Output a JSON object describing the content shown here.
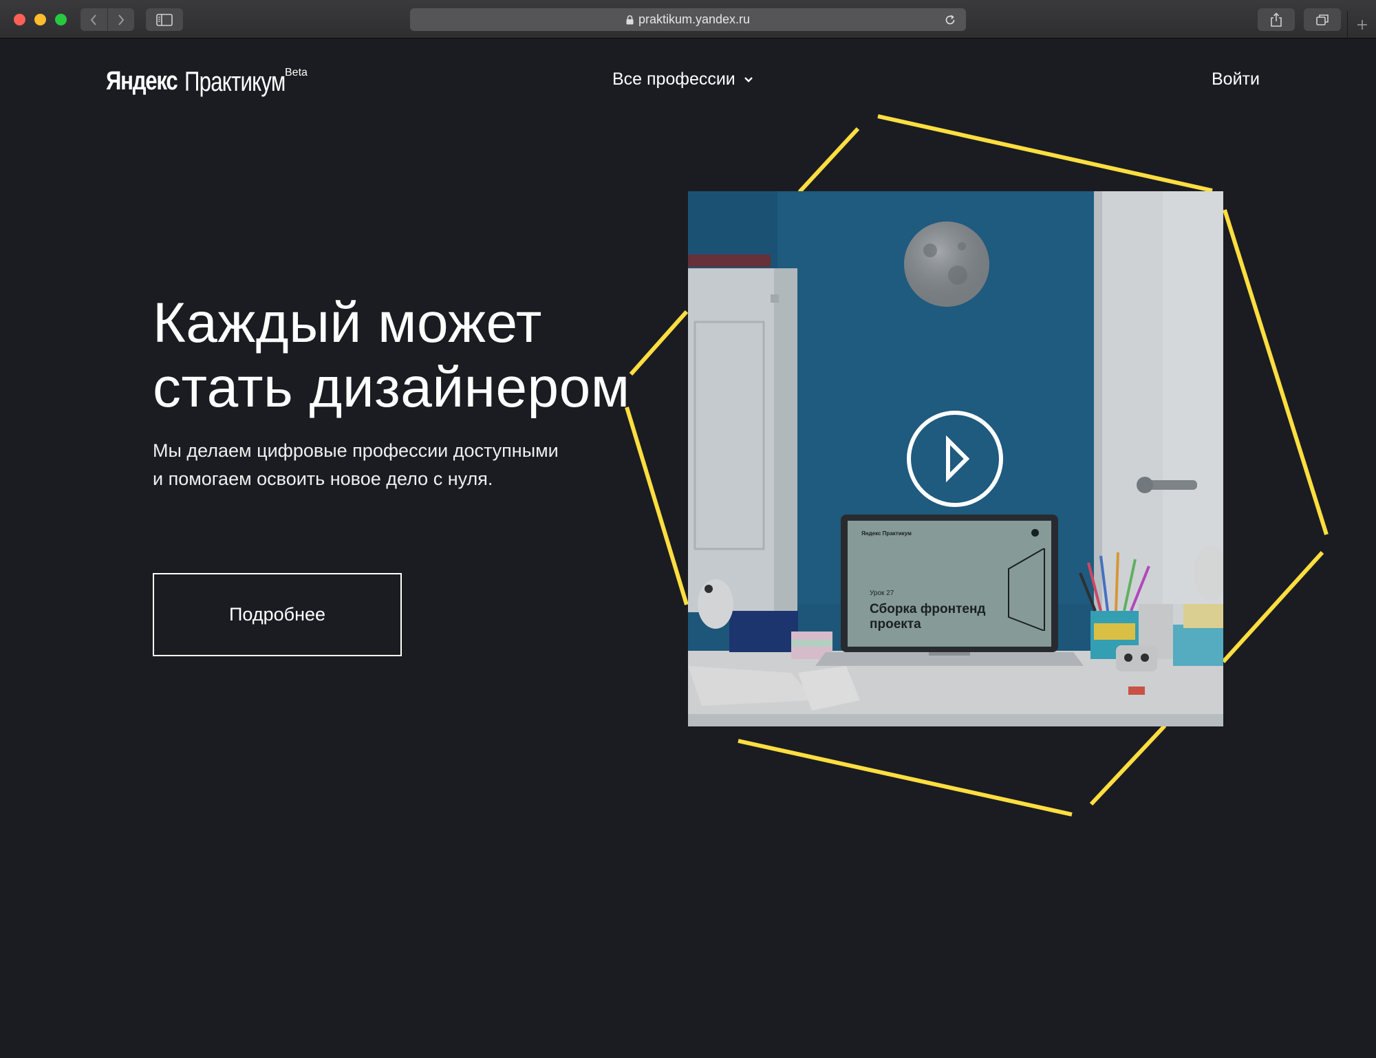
{
  "browser": {
    "url": "praktikum.yandex.ru"
  },
  "header": {
    "logo_yandex": "Яндекс",
    "logo_praktikum": "Практикум",
    "logo_badge": "Beta",
    "nav_professions": "Все профессии",
    "login": "Войти"
  },
  "hero": {
    "title_line1": "Каждый может",
    "title_line2": "стать дизайнером",
    "subtitle_line1": "Мы делаем цифровые профессии доступными",
    "subtitle_line2": "и помогаем освоить новое дело с нуля.",
    "more_button": "Подробнее"
  },
  "video": {
    "screen_brand": "Яндекс Практикум",
    "screen_lesson": "Урок 27",
    "screen_title_line1": "Сборка фронтенд",
    "screen_title_line2": "проекта"
  },
  "colors": {
    "background": "#1b1c22",
    "accent_yellow": "#ffde40",
    "video_wall": "#1f5f86"
  },
  "icons": [
    "back-icon",
    "forward-icon",
    "sidebar-icon",
    "lock-icon",
    "reload-icon",
    "share-icon",
    "tabs-icon",
    "plus-icon",
    "chevron-down-icon",
    "play-icon"
  ]
}
